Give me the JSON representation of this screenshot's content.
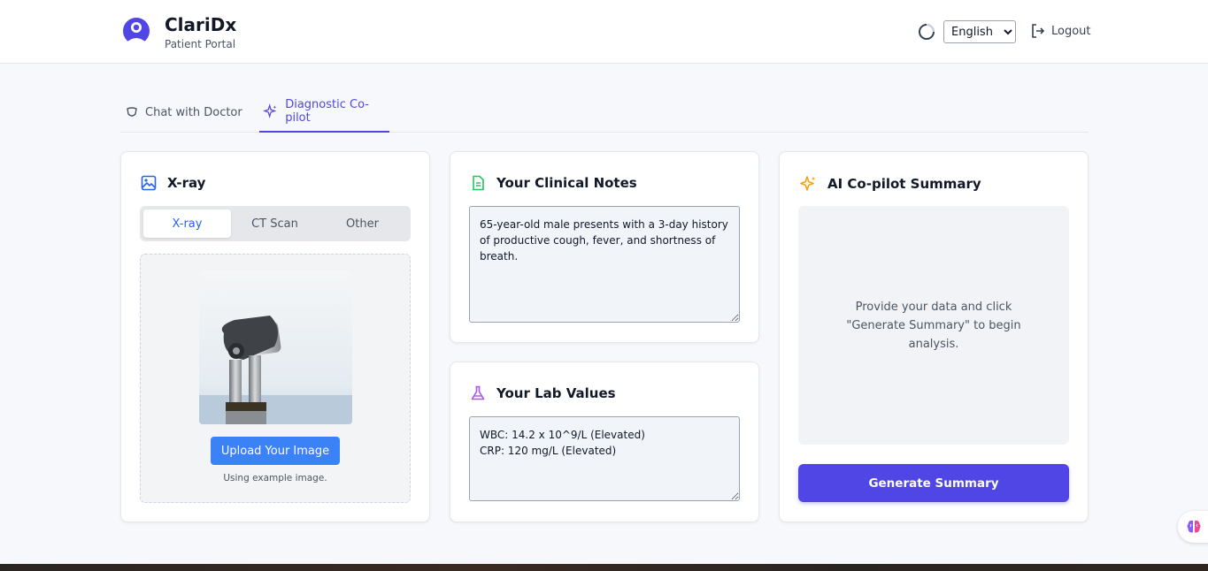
{
  "header": {
    "app_name": "ClariDx",
    "app_subtitle": "Patient Portal",
    "language": {
      "selected": "English",
      "options": [
        "English"
      ]
    },
    "logout_label": "Logout"
  },
  "tabs": [
    {
      "label": "Chat with Doctor",
      "icon": "shield-icon",
      "active": false
    },
    {
      "label": "Diagnostic Co-pilot",
      "icon": "sparkles-icon",
      "active": true
    }
  ],
  "xray_card": {
    "title": "X-ray",
    "modalities": [
      "X-ray",
      "CT Scan",
      "Other"
    ],
    "selected_modality": "X-ray",
    "upload_label": "Upload Your Image",
    "note": "Using example image."
  },
  "notes_card": {
    "title": "Your Clinical Notes",
    "value": "65-year-old male presents with a 3-day history of productive cough, fever, and shortness of breath."
  },
  "labs_card": {
    "title": "Your Lab Values",
    "value": "WBC: 14.2 x 10^9/L (Elevated)\nCRP: 120 mg/L (Elevated)"
  },
  "summary_card": {
    "title": "AI Co-pilot Summary",
    "placeholder": "Provide your data and click \"Generate Summary\" to begin analysis.",
    "button_label": "Generate Summary"
  },
  "colors": {
    "primary": "#4f46e5",
    "upload_blue": "#3b82f6",
    "notes_icon": "#22c55e",
    "labs_icon": "#a855f7",
    "summary_icon": "#f59e0b"
  }
}
